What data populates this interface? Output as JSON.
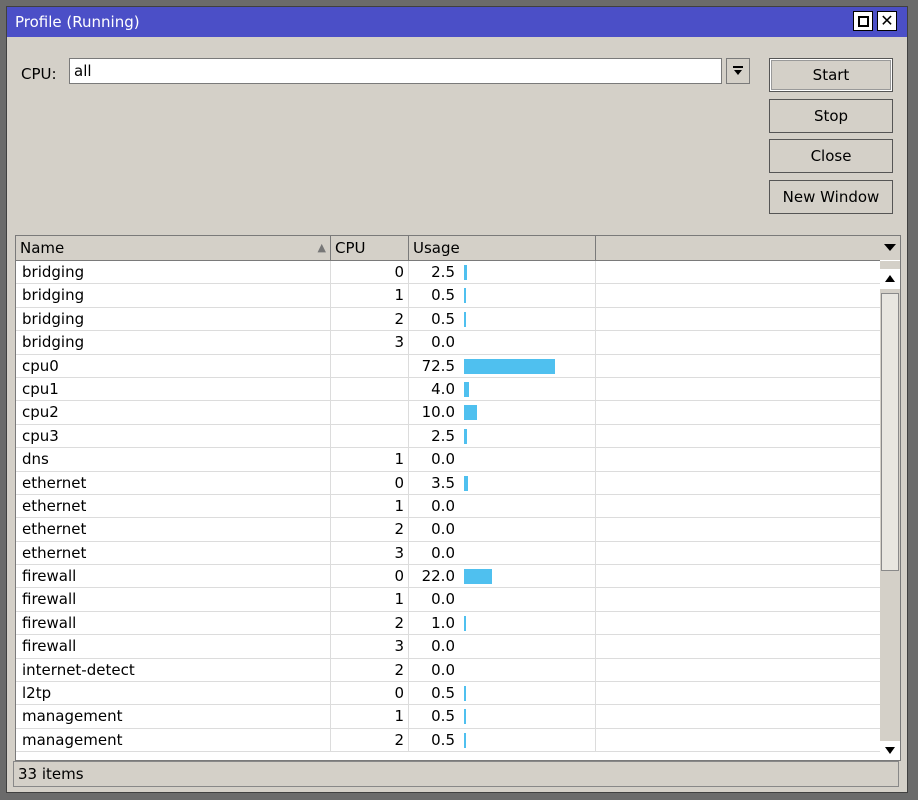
{
  "window": {
    "title": "Profile (Running)",
    "maximize_icon": "maximize-icon",
    "close_icon": "close-icon",
    "close_glyph": "✕"
  },
  "filter": {
    "label": "CPU:",
    "value": "all",
    "dropdown_icon": "dropdown-arrow-icon"
  },
  "buttons": {
    "start": "Start",
    "stop": "Stop",
    "close": "Close",
    "new_window": "New Window"
  },
  "table": {
    "columns": [
      "Name",
      "CPU",
      "Usage"
    ],
    "sort_indicator": "▲",
    "rows": [
      {
        "name": "bridging",
        "cpu": "0",
        "usage": "2.5"
      },
      {
        "name": "bridging",
        "cpu": "1",
        "usage": "0.5"
      },
      {
        "name": "bridging",
        "cpu": "2",
        "usage": "0.5"
      },
      {
        "name": "bridging",
        "cpu": "3",
        "usage": "0.0"
      },
      {
        "name": "cpu0",
        "cpu": "",
        "usage": "72.5"
      },
      {
        "name": "cpu1",
        "cpu": "",
        "usage": "4.0"
      },
      {
        "name": "cpu2",
        "cpu": "",
        "usage": "10.0"
      },
      {
        "name": "cpu3",
        "cpu": "",
        "usage": "2.5"
      },
      {
        "name": "dns",
        "cpu": "1",
        "usage": "0.0"
      },
      {
        "name": "ethernet",
        "cpu": "0",
        "usage": "3.5"
      },
      {
        "name": "ethernet",
        "cpu": "1",
        "usage": "0.0"
      },
      {
        "name": "ethernet",
        "cpu": "2",
        "usage": "0.0"
      },
      {
        "name": "ethernet",
        "cpu": "3",
        "usage": "0.0"
      },
      {
        "name": "firewall",
        "cpu": "0",
        "usage": "22.0"
      },
      {
        "name": "firewall",
        "cpu": "1",
        "usage": "0.0"
      },
      {
        "name": "firewall",
        "cpu": "2",
        "usage": "1.0"
      },
      {
        "name": "firewall",
        "cpu": "3",
        "usage": "0.0"
      },
      {
        "name": "internet-detect",
        "cpu": "2",
        "usage": "0.0"
      },
      {
        "name": "l2tp",
        "cpu": "0",
        "usage": "0.5"
      },
      {
        "name": "management",
        "cpu": "1",
        "usage": "0.5"
      },
      {
        "name": "management",
        "cpu": "2",
        "usage": "0.5"
      }
    ],
    "bar_color": "#4fc0ef"
  },
  "status": {
    "items_count": "33 items"
  }
}
